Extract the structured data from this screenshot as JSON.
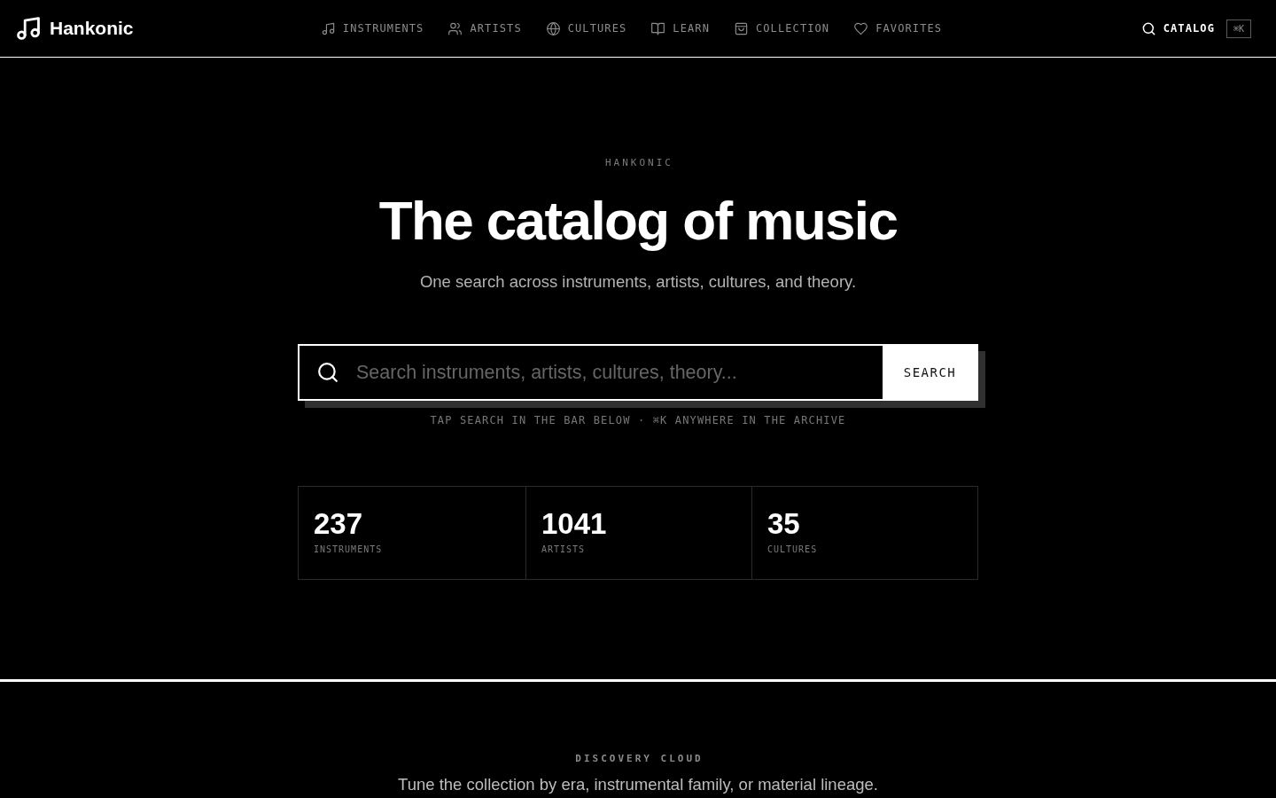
{
  "header": {
    "brand": "Hankonic",
    "nav": [
      {
        "label": "INSTRUMENTS"
      },
      {
        "label": "ARTISTS"
      },
      {
        "label": "CULTURES"
      },
      {
        "label": "LEARN"
      },
      {
        "label": "COLLECTION"
      },
      {
        "label": "FAVORITES"
      }
    ],
    "catalog": "CATALOG",
    "shortcut": "⌘K"
  },
  "hero": {
    "eyebrow": "HANKONIC",
    "title": "The catalog of music",
    "subtitle": "One search across instruments, artists, cultures, and theory.",
    "search": {
      "placeholder": "Search instruments, artists, cultures, theory...",
      "button": "SEARCH"
    },
    "hint": "TAP SEARCH IN THE BAR BELOW · ⌘K ANYWHERE IN THE ARCHIVE",
    "stats": [
      {
        "value": "237",
        "label": "INSTRUMENTS"
      },
      {
        "value": "1041",
        "label": "ARTISTS"
      },
      {
        "value": "35",
        "label": "CULTURES"
      }
    ]
  },
  "discovery": {
    "eyebrow": "DISCOVERY CLOUD",
    "text": "Tune the collection by era, instrumental family, or material lineage."
  }
}
